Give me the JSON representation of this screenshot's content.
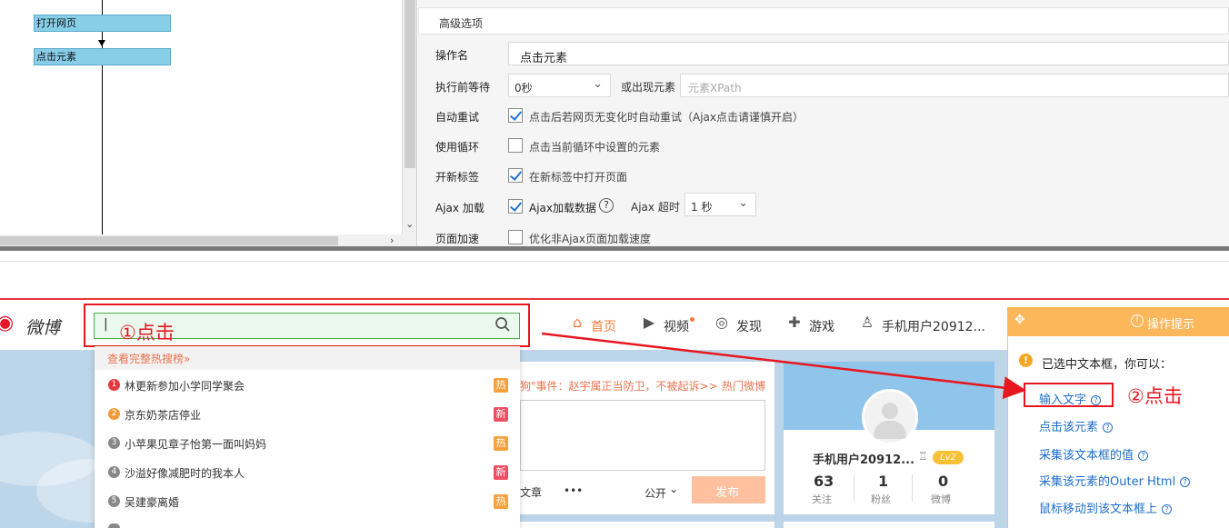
{
  "flow": {
    "nodes": [
      "打开网页",
      "点击元素"
    ]
  },
  "options": {
    "header_title": "高级选项",
    "op_name_label": "操作名",
    "op_name_value": "点击元素",
    "wait_label": "执行前等待",
    "wait_value": "0秒",
    "or_appear_label": "或出现元素",
    "xpath_placeholder": "元素XPath",
    "retry_label": "自动重试",
    "retry_text": "点击后若网页无变化时自动重试（Ajax点击请谨慎开启）",
    "loop_label": "使用循环",
    "loop_text": "点击当前循环中设置的元素",
    "newtab_label": "开新标签",
    "newtab_text": "在新标签中打开页面",
    "ajax_label": "Ajax 加载",
    "ajax_text": "Ajax加载数据",
    "ajax_timeout_label": "Ajax 超时",
    "ajax_timeout_value": "1 秒",
    "speed_label": "页面加速",
    "speed_text": "优化非Ajax页面加载速度"
  },
  "weibo": {
    "logo_text": "微博",
    "search_cursor": "|",
    "nav": {
      "home": "首页",
      "video": "视频",
      "discover": "发现",
      "games": "游戏",
      "user": "手机用户20912..."
    },
    "dropdown": {
      "header": "查看完整热搜榜»",
      "items": [
        {
          "num": "1",
          "text": "林更新参加小学同学聚会",
          "tag": "热"
        },
        {
          "num": "2",
          "text": "京东奶茶店停业",
          "tag": "新"
        },
        {
          "num": "3",
          "text": "小苹果见章子怡第一面叫妈妈",
          "tag": "热"
        },
        {
          "num": "4",
          "text": "沙溢好像减肥时的我本人",
          "tag": "新"
        },
        {
          "num": "5",
          "text": "吴建豪离婚",
          "tag": "热"
        }
      ]
    },
    "post": {
      "headline": "狗\"事件：赵宇属正当防卫，不被起诉>>",
      "hot_label": "热门微博",
      "article": "文章",
      "more": "•••",
      "public": "公开",
      "publish": "发布"
    },
    "profile": {
      "name": "手机用户20912...",
      "level": "Lv2",
      "stats": [
        {
          "value": "63",
          "label": "关注"
        },
        {
          "value": "1",
          "label": "粉丝"
        },
        {
          "value": "0",
          "label": "微博"
        }
      ]
    }
  },
  "hint": {
    "title": "操作提示",
    "intro": "已选中文本框，你可以：",
    "links": [
      "输入文字",
      "点击该元素",
      "采集该文本框的值",
      "采集该元素的Outer Html",
      "鼠标移动到该文本框上"
    ]
  },
  "annotations": {
    "step1": "①点击",
    "step2": "②点击"
  },
  "colors": {
    "accent_red": "#e8161e",
    "weibo_orange": "#fa7d3c",
    "link_blue": "#1e6ec8",
    "hint_orange": "#fbb759"
  }
}
